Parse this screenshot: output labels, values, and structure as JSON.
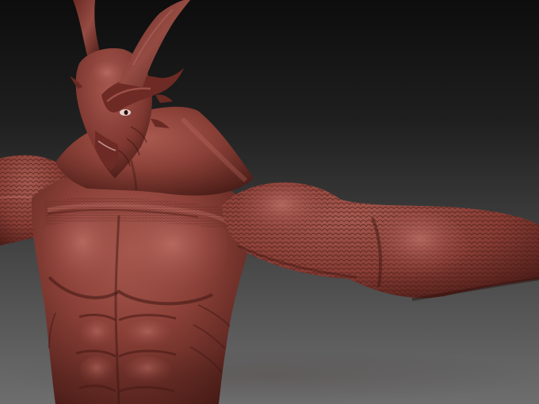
{
  "viewport": {
    "background": "gradient-dark-to-grey",
    "subject": "sculpted-horned-creature-torso",
    "material_color": "#8a3f38",
    "highlight_color": "#b86a5f",
    "shadow_color": "#3e1612"
  }
}
